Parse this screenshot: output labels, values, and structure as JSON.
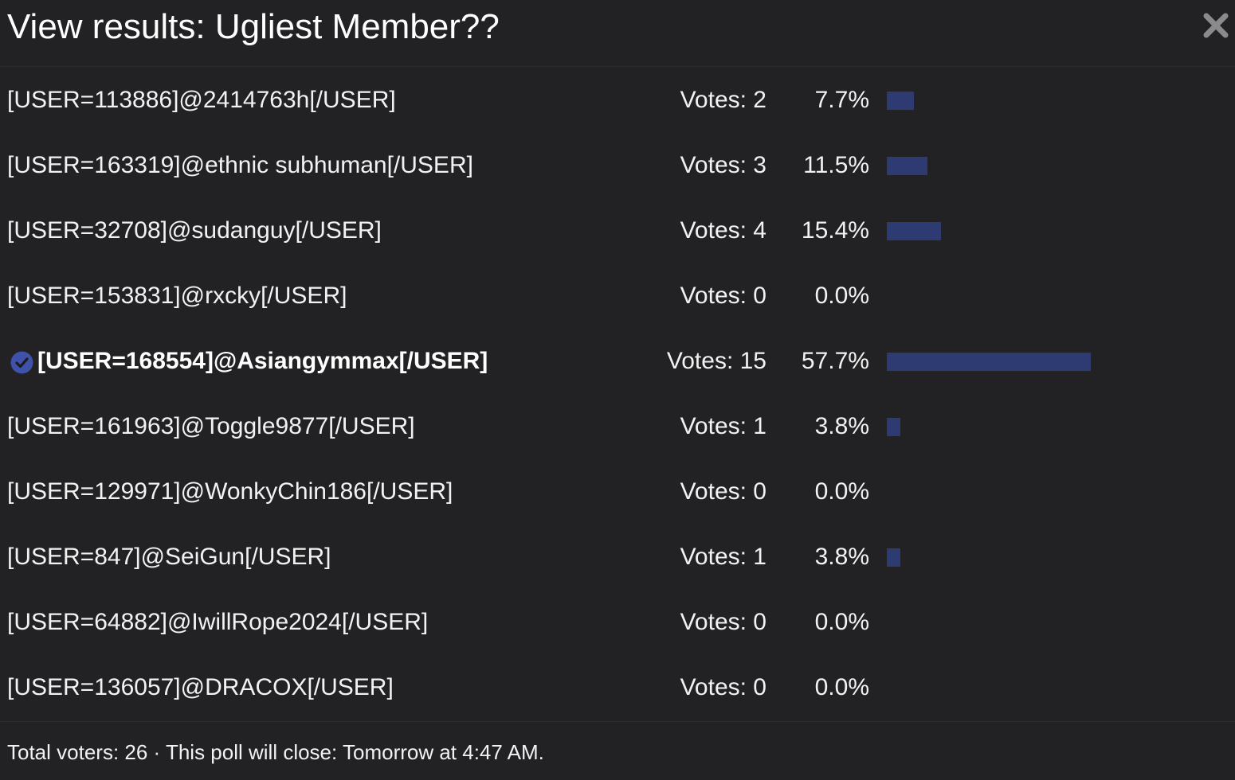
{
  "dialog": {
    "title": "View results: Ugliest Member??",
    "close_icon": "close-icon"
  },
  "results": [
    {
      "label": "[USER=113886]@2414763h[/USER]",
      "votes_text": "Votes: 2",
      "percent_text": "7.7%",
      "percent": 7.7,
      "voted": false
    },
    {
      "label": "[USER=163319]@ethnic subhuman[/USER]",
      "votes_text": "Votes: 3",
      "percent_text": "11.5%",
      "percent": 11.5,
      "voted": false
    },
    {
      "label": "[USER=32708]@sudanguy[/USER]",
      "votes_text": "Votes: 4",
      "percent_text": "15.4%",
      "percent": 15.4,
      "voted": false
    },
    {
      "label": "[USER=153831]@rxcky[/USER]",
      "votes_text": "Votes: 0",
      "percent_text": "0.0%",
      "percent": 0.0,
      "voted": false
    },
    {
      "label": "[USER=168554]@Asiangymmax[/USER]",
      "votes_text": "Votes: 15",
      "percent_text": "57.7%",
      "percent": 57.7,
      "voted": true
    },
    {
      "label": "[USER=161963]@Toggle9877[/USER]",
      "votes_text": "Votes: 1",
      "percent_text": "3.8%",
      "percent": 3.8,
      "voted": false
    },
    {
      "label": "[USER=129971]@WonkyChin186[/USER]",
      "votes_text": "Votes: 0",
      "percent_text": "0.0%",
      "percent": 0.0,
      "voted": false
    },
    {
      "label": "[USER=847]@SeiGun[/USER]",
      "votes_text": "Votes: 1",
      "percent_text": "3.8%",
      "percent": 3.8,
      "voted": false
    },
    {
      "label": "[USER=64882]@IwillRope2024[/USER]",
      "votes_text": "Votes: 0",
      "percent_text": "0.0%",
      "percent": 0.0,
      "voted": false
    },
    {
      "label": "[USER=136057]@DRACOX[/USER]",
      "votes_text": "Votes: 0",
      "percent_text": "0.0%",
      "percent": 0.0,
      "voted": false
    }
  ],
  "footer": {
    "text": "Total voters: 26 · This poll will close: Tomorrow at 4:47 AM."
  },
  "colors": {
    "background": "#222224",
    "bar": "#2e3b73",
    "check_icon": "#3f51a8"
  }
}
